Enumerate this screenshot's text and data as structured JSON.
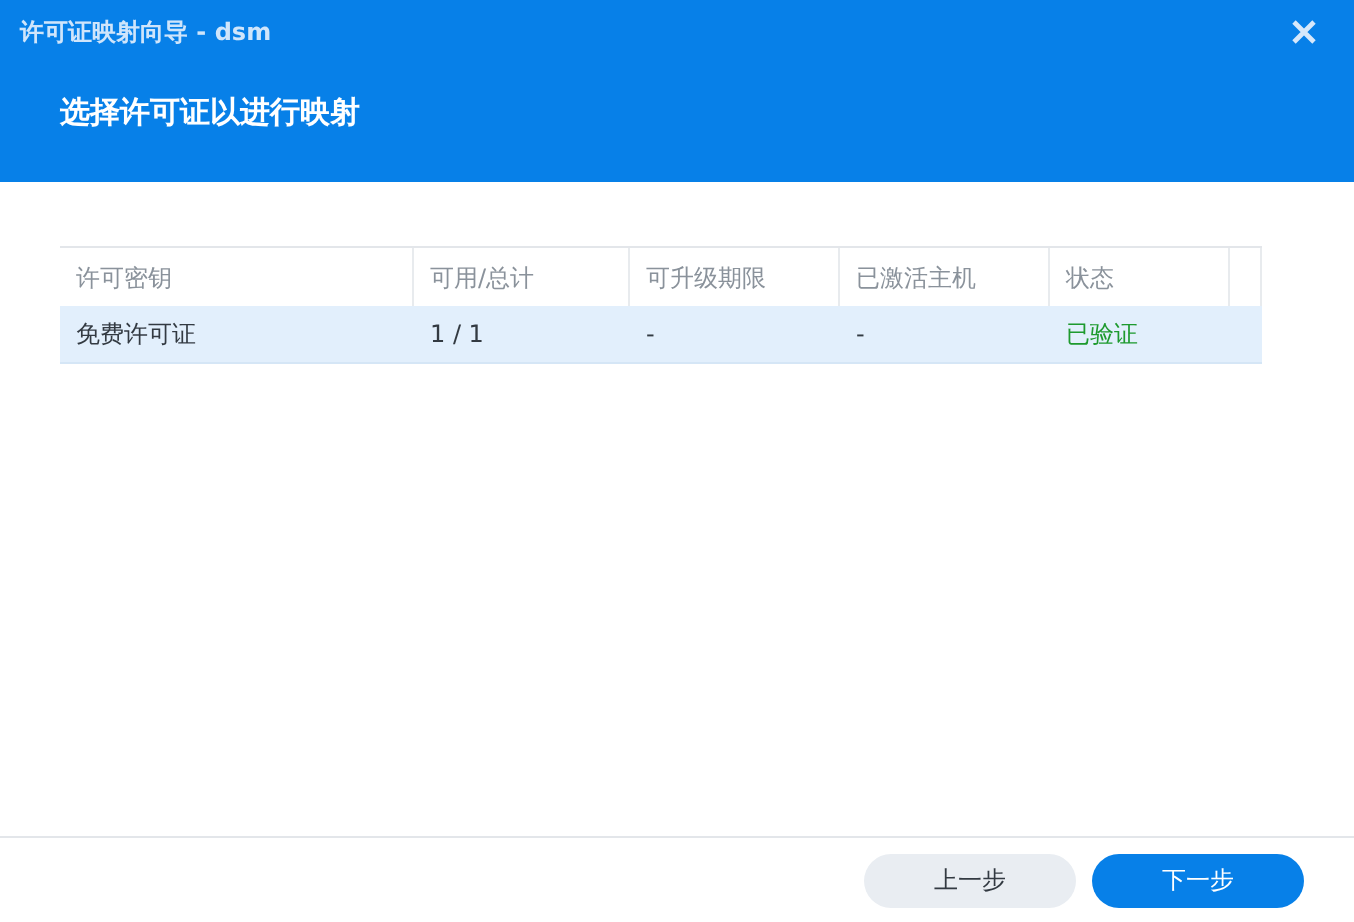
{
  "window": {
    "title": "许可证映射向导 - dsm"
  },
  "header": {
    "title": "选择许可证以进行映射"
  },
  "table": {
    "columns": [
      "许可密钥",
      "可用/总计",
      "可升级期限",
      "已激活主机",
      "状态"
    ],
    "rows": [
      {
        "selected": true,
        "cells": [
          "免费许可证",
          "1 / 1",
          "-",
          "-",
          "已验证"
        ],
        "color": "#1e9a2e"
      }
    ]
  },
  "buttons": [
    {
      "label": "上一步",
      "kind": "secondary"
    },
    {
      "label": "下一步",
      "kind": "primary"
    }
  ]
}
